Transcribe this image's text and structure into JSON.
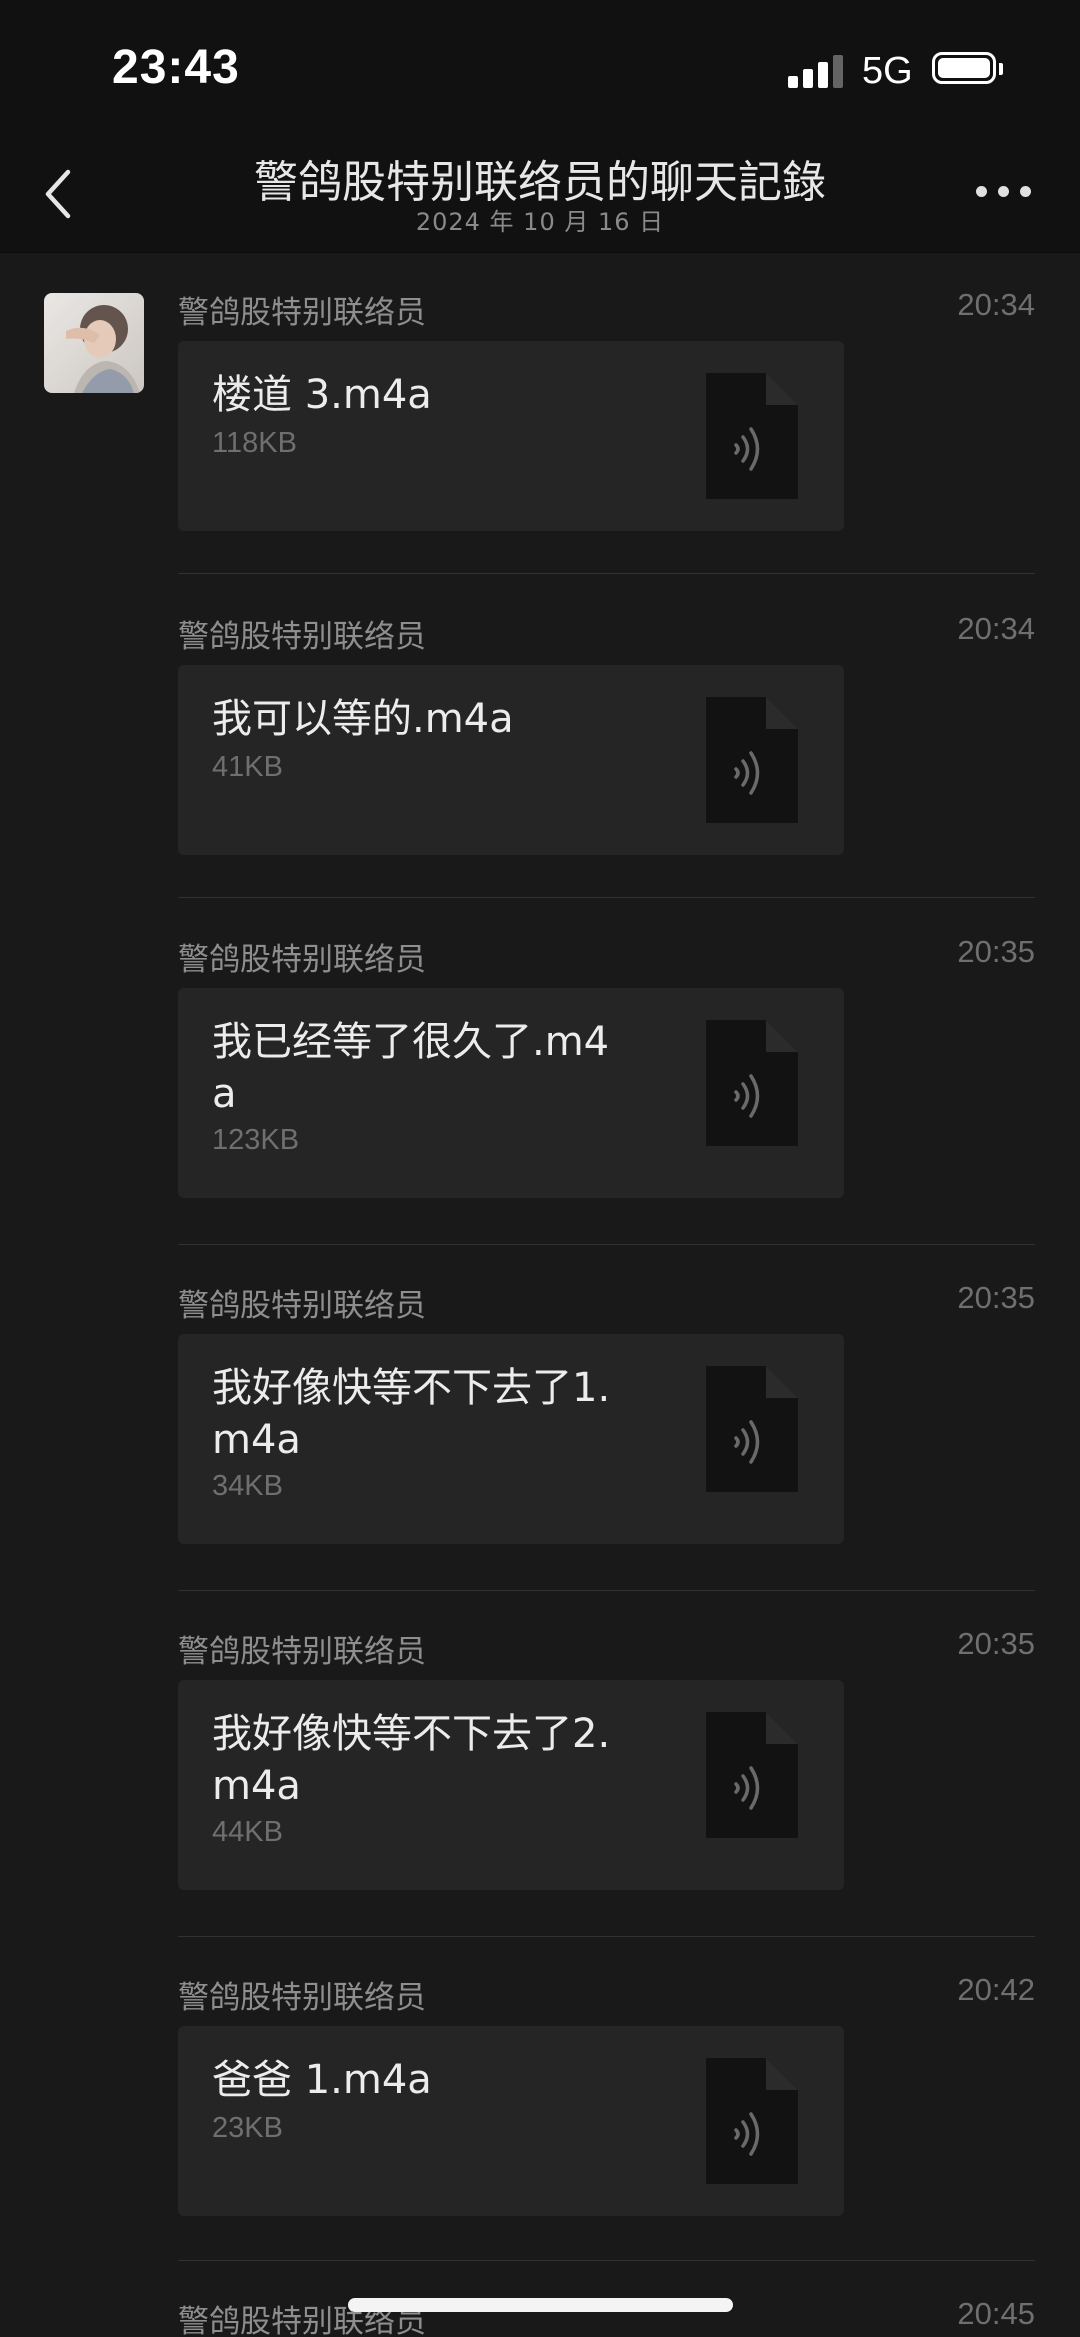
{
  "status_bar": {
    "time": "23:43",
    "network": "5G"
  },
  "header": {
    "title": "警鸽股特别联络员的聊天記錄",
    "date": "2024 年 10 月 16 日"
  },
  "messages": [
    {
      "sender": "警鸽股特别联络员",
      "time": "20:34",
      "file_name": "楼道 3.m4a",
      "file_size": "118KB"
    },
    {
      "sender": "警鸽股特别联络员",
      "time": "20:34",
      "file_name": "我可以等的.m4a",
      "file_size": "41KB"
    },
    {
      "sender": "警鸽股特别联络员",
      "time": "20:35",
      "file_name": "我已经等了很久了.m4a",
      "file_size": "123KB"
    },
    {
      "sender": "警鸽股特别联络员",
      "time": "20:35",
      "file_name": "我好像快等不下去了1.m4a",
      "file_size": "34KB"
    },
    {
      "sender": "警鸽股特别联络员",
      "time": "20:35",
      "file_name": "我好像快等不下去了2.m4a",
      "file_size": "44KB"
    },
    {
      "sender": "警鸽股特别联络员",
      "time": "20:42",
      "file_name": "爸爸 1.m4a",
      "file_size": "23KB"
    },
    {
      "sender": "警鸽股特别联络员",
      "time": "20:45"
    }
  ],
  "icons": {
    "back": "chevron-left-icon",
    "more": "more-dots-icon",
    "file": "audio-file-icon"
  },
  "colors": {
    "background": "#191919",
    "header": "#111111",
    "card": "#252525"
  }
}
